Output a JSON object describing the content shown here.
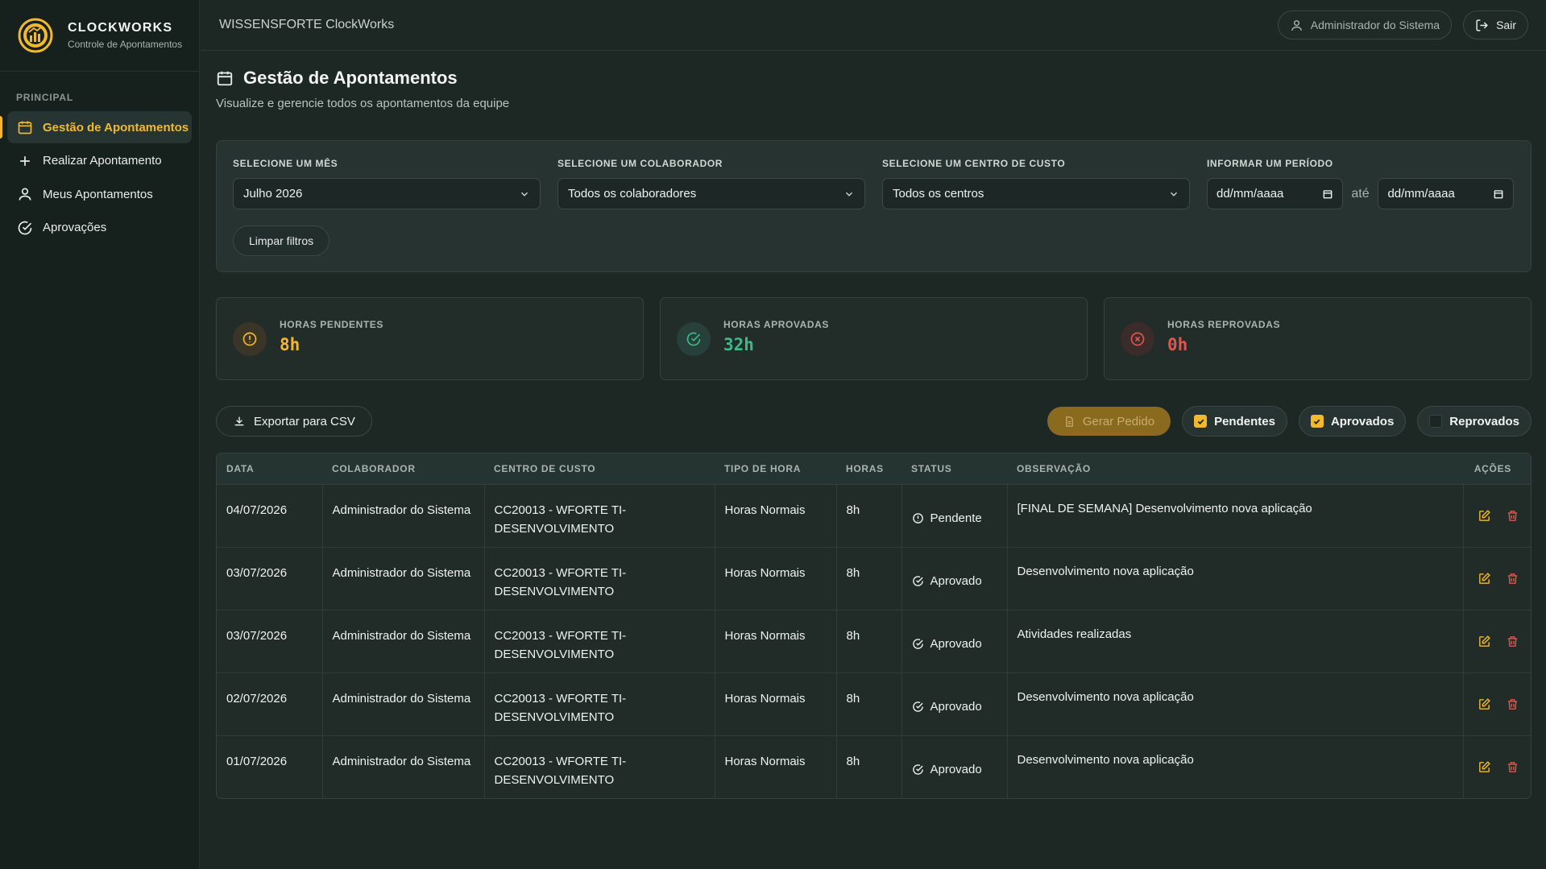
{
  "brand": {
    "name": "CLOCKWORKS",
    "subtitle": "Controle de Apontamentos"
  },
  "sidebar": {
    "section": "PRINCIPAL",
    "items": [
      {
        "label": "Gestão de Apontamentos",
        "icon": "calendar-icon",
        "active": true
      },
      {
        "label": "Realizar Apontamento",
        "icon": "plus-icon"
      },
      {
        "label": "Meus Apontamentos",
        "icon": "user-icon"
      },
      {
        "label": "Aprovações",
        "icon": "check-circle-icon"
      }
    ]
  },
  "topbar": {
    "title": "WISSENSFORTE ClockWorks",
    "user": "Administrador do Sistema",
    "logout": "Sair"
  },
  "page": {
    "title": "Gestão de Apontamentos",
    "subtitle": "Visualize e gerencie todos os apontamentos da equipe"
  },
  "filters": {
    "month_label": "SELECIONE UM MÊS",
    "month_value": "Julho 2026",
    "collab_label": "SELECIONE UM COLABORADOR",
    "collab_value": "Todos os colaboradores",
    "cost_label": "SELECIONE UM CENTRO DE CUSTO",
    "cost_value": "Todos os centros",
    "period_label": "INFORMAR UM PERÍODO",
    "date_from": "dd/mm/aaaa",
    "date_sep": "até",
    "date_to": "dd/mm/aaaa",
    "clear": "Limpar filtros"
  },
  "stats": {
    "pending_label": "HORAS PENDENTES",
    "pending_value": "8h",
    "approved_label": "HORAS APROVADAS",
    "approved_value": "32h",
    "rejected_label": "HORAS REPROVADAS",
    "rejected_value": "0h"
  },
  "toolbar": {
    "export": "Exportar para CSV",
    "gerar": "Gerar Pedido",
    "chip_pendentes": "Pendentes",
    "chip_aprovados": "Aprovados",
    "chip_reprovados": "Reprovados"
  },
  "table": {
    "headers": [
      "DATA",
      "COLABORADOR",
      "CENTRO DE CUSTO",
      "TIPO DE HORA",
      "HORAS",
      "STATUS",
      "OBSERVAÇÃO",
      "AÇÕES"
    ],
    "rows": [
      {
        "date": "04/07/2026",
        "collab": "Administrador do Sistema",
        "cost": "CC20013 - WFORTE TI-DESENVOLVIMENTO",
        "type": "Horas Normais",
        "hours": "8h",
        "status": "Pendente",
        "obs": "[FINAL DE SEMANA] Desenvolvimento nova aplicação"
      },
      {
        "date": "03/07/2026",
        "collab": "Administrador do Sistema",
        "cost": "CC20013 - WFORTE TI-DESENVOLVIMENTO",
        "type": "Horas Normais",
        "hours": "8h",
        "status": "Aprovado",
        "obs": "Desenvolvimento nova aplicação"
      },
      {
        "date": "03/07/2026",
        "collab": "Administrador do Sistema",
        "cost": "CC20013 - WFORTE TI-DESENVOLVIMENTO",
        "type": "Horas Normais",
        "hours": "8h",
        "status": "Aprovado",
        "obs": "Atividades realizadas"
      },
      {
        "date": "02/07/2026",
        "collab": "Administrador do Sistema",
        "cost": "CC20013 - WFORTE TI-DESENVOLVIMENTO",
        "type": "Horas Normais",
        "hours": "8h",
        "status": "Aprovado",
        "obs": "Desenvolvimento nova aplicação"
      },
      {
        "date": "01/07/2026",
        "collab": "Administrador do Sistema",
        "cost": "CC20013 - WFORTE TI-DESENVOLVIMENTO",
        "type": "Horas Normais",
        "hours": "8h",
        "status": "Aprovado",
        "obs": "Desenvolvimento nova aplicação"
      }
    ]
  },
  "colors": {
    "accent": "#f2b92d",
    "approved": "#3fb88a",
    "rejected": "#e0554d",
    "pending": "#f2b92d"
  }
}
